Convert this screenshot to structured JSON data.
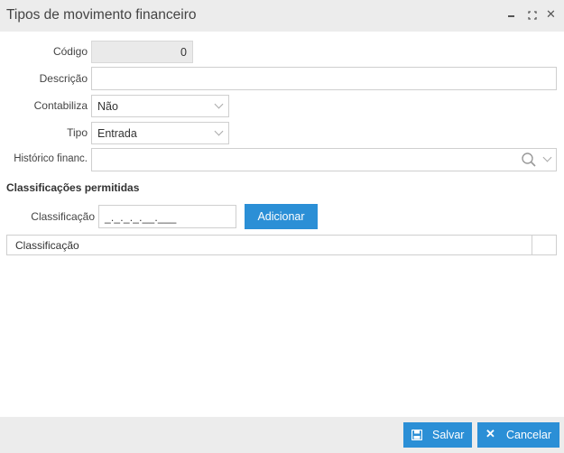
{
  "window": {
    "title": "Tipos de movimento financeiro"
  },
  "form": {
    "codigo_label": "Código",
    "codigo_value": "0",
    "descricao_label": "Descrição",
    "descricao_value": "",
    "contabiliza_label": "Contabiliza",
    "contabiliza_value": "Não",
    "tipo_label": "Tipo",
    "tipo_value": "Entrada",
    "historico_label": "Histórico financ.",
    "historico_value": ""
  },
  "classificacoes": {
    "section_title": "Classificações permitidas",
    "classificacao_label": "Classificação",
    "classificacao_mask": "_._._._.__.___",
    "add_button": "Adicionar",
    "table_header": "Classificação"
  },
  "footer": {
    "save_label": "Salvar",
    "cancel_label": "Cancelar"
  },
  "colors": {
    "primary": "#2b8fd6",
    "titlebar": "#ececec"
  }
}
